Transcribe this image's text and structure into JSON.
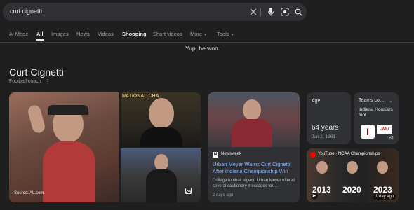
{
  "search": {
    "query": "curt cignetti",
    "icons": [
      "close-icon",
      "microphone-icon",
      "camera-lens-icon",
      "search-icon"
    ]
  },
  "tabs": [
    {
      "label": "Ai Mode"
    },
    {
      "label": "All"
    },
    {
      "label": "Images"
    },
    {
      "label": "News"
    },
    {
      "label": "Videos"
    },
    {
      "label": "Shopping"
    },
    {
      "label": "Short videos"
    },
    {
      "label": "More"
    },
    {
      "label": "Tools"
    }
  ],
  "answer": "Yup, he won.",
  "entity": {
    "title": "Curt Cignetti",
    "subtitle": "Football coach"
  },
  "images": {
    "source": "Source: AL.com",
    "photo2_text": "NATIONAL CHA"
  },
  "news": {
    "source_letter": "N",
    "source": "Newsweek",
    "headline": "Urban Meyer Warns Curt Cignetti After Indiana Championship Win",
    "snippet": "College football legend Urban Meyer offered several cautionary messages for…",
    "age": "2 days ago"
  },
  "facts": {
    "age": {
      "label": "Age",
      "value": "64 years",
      "sub": "Jun 2, 1961"
    },
    "teams": {
      "label": "Teams co…",
      "value": "Indiana Hoosiers foot…",
      "logo1": "I",
      "logo2": "JMU",
      "more": "+2"
    }
  },
  "video": {
    "label": "YouTube · NCAA Championships",
    "years": [
      "2013",
      "2020",
      "2023"
    ],
    "ago": "1 day ago"
  },
  "colors": {
    "background": "#1f1f1f",
    "card": "#303134",
    "link": "#8ab4f8",
    "youtube": "#ff0000"
  }
}
